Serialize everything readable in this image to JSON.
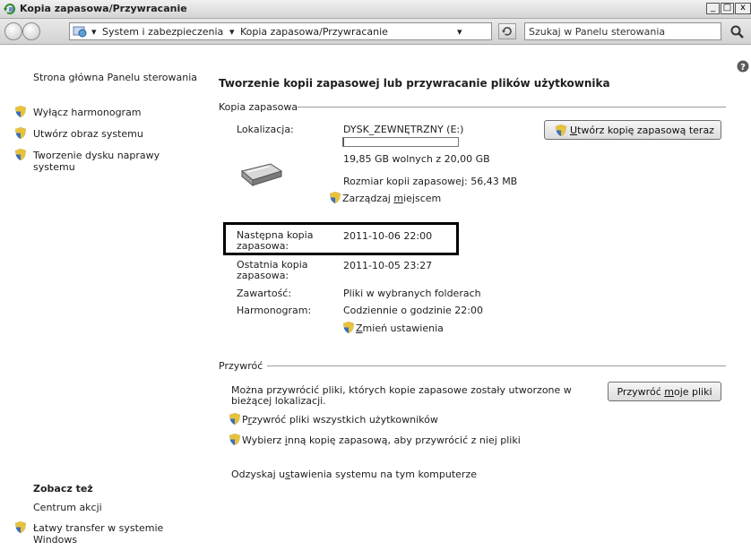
{
  "window": {
    "title": "Kopia zapasowa/Przywracanie"
  },
  "address": {
    "crumbs": [
      "System i zabezpieczenia",
      "Kopia zapasowa/Przywracanie"
    ],
    "search_placeholder": "Szukaj w Panelu sterowania"
  },
  "sidebar": {
    "home_link": "Strona główna Panelu sterowania",
    "items": [
      {
        "label": "Wyłącz harmonogram"
      },
      {
        "label": "Utwórz obraz systemu"
      },
      {
        "label_line1": "Tworzenie dysku naprawy",
        "label_line2": "systemu"
      }
    ],
    "see_also": {
      "heading": "Zobacz też",
      "items": [
        {
          "label": "Centrum akcji"
        },
        {
          "label_line1": "Łatwy transfer w systemie",
          "label_line2": "Windows"
        }
      ]
    }
  },
  "main": {
    "heading": "Tworzenie kopii zapasowej lub przywracanie plików użytkownika",
    "backup": {
      "section_title": "Kopia zapasowa",
      "location_label": "Lokalizacja:",
      "location_value": "DYSK_ZEWNĘTRZNY (E:)",
      "disk_used_fraction": 0.01,
      "free_space": "19,85 GB wolnych z 20,00 GB",
      "backup_size": "Rozmiar kopii zapasowej: 56,43 MB",
      "manage_space_link": {
        "pre": "Zarządzaj ",
        "key": "m",
        "post": "iejscem"
      },
      "backup_now_button": {
        "key": "U",
        "rest": "twórz kopię zapasową teraz"
      },
      "next_backup_label_line1": "Następna kopia",
      "next_backup_label_line2": "zapasowa:",
      "next_backup_value": "2011-10-06 22:00",
      "last_backup_label_line1": "Ostatnia kopia",
      "last_backup_label_line2": "zapasowa:",
      "last_backup_value": "2011-10-05 23:27",
      "contents_label": "Zawartość:",
      "contents_value": "Pliki w wybranych folderach",
      "schedule_label": "Harmonogram:",
      "schedule_value": "Codziennie o godzinie 22:00",
      "change_settings_link": {
        "key": "Z",
        "rest": "mień ustawienia"
      }
    },
    "restore": {
      "section_title": "Przywróć",
      "description_line1": "Można przywrócić pliki, których kopie zapasowe zostały utworzone w",
      "description_line2": "bieżącej lokalizacji.",
      "restore_my_files_button": {
        "pre": "Przywróć ",
        "key": "m",
        "post": "oje pliki"
      },
      "restore_all_users_link": {
        "pre": "P",
        "key": "r",
        "post": "zywróć pliki wszystkich użytkowników"
      },
      "choose_other_link": {
        "pre": "Wybierz ",
        "key": "i",
        "post": "nną kopię zapasową, aby przywrócić z niej pliki"
      },
      "recover_settings_link": {
        "pre": "Odzyskaj u",
        "key": "s",
        "post": "tawienia systemu na tym komputerze"
      }
    }
  },
  "colors": {
    "highlight_box": "#000000",
    "shield_blue": "#3d6fb8",
    "shield_yellow": "#e8c23a"
  }
}
